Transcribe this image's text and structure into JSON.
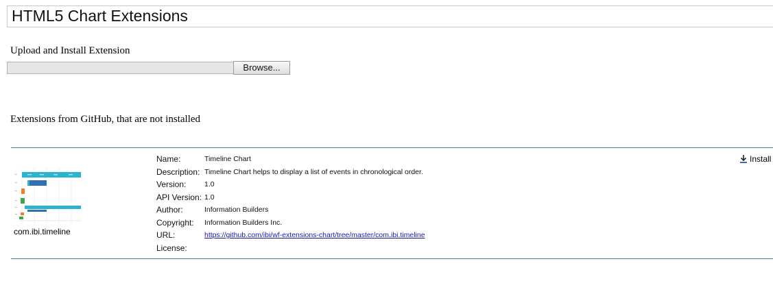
{
  "page": {
    "title": "HTML5 Chart Extensions"
  },
  "upload": {
    "heading": "Upload and Install Extension",
    "file_value": "",
    "browse_label": "Browse..."
  },
  "github": {
    "heading": "Extensions from GitHub, that are not installed"
  },
  "extension": {
    "id": "com.ibi.timeline",
    "install_label": "Install",
    "install_icon": "download-icon",
    "fields": [
      {
        "label": "Name:",
        "value": "Timeline Chart"
      },
      {
        "label": "Description:",
        "value": "Timeline Chart helps to display a list of events in chronological order."
      },
      {
        "label": "Version:",
        "value": "1.0"
      },
      {
        "label": "API Version:",
        "value": "1.0"
      },
      {
        "label": "Author:",
        "value": "Information Builders"
      },
      {
        "label": "Copyright:",
        "value": "Information Builders Inc."
      },
      {
        "label": "URL:",
        "value": "https://github.com/ibi/wf-extensions-chart/tree/master/com.ibi.timeline"
      },
      {
        "label": "License:",
        "value": ""
      }
    ]
  },
  "colors": {
    "rule": "#5a7a9e",
    "link": "#1a1aa8",
    "thumb_cyan": "#2ab4d0",
    "thumb_blue": "#2f6fb6",
    "thumb_orange": "#f07f2a",
    "thumb_green": "#3aa84a"
  }
}
